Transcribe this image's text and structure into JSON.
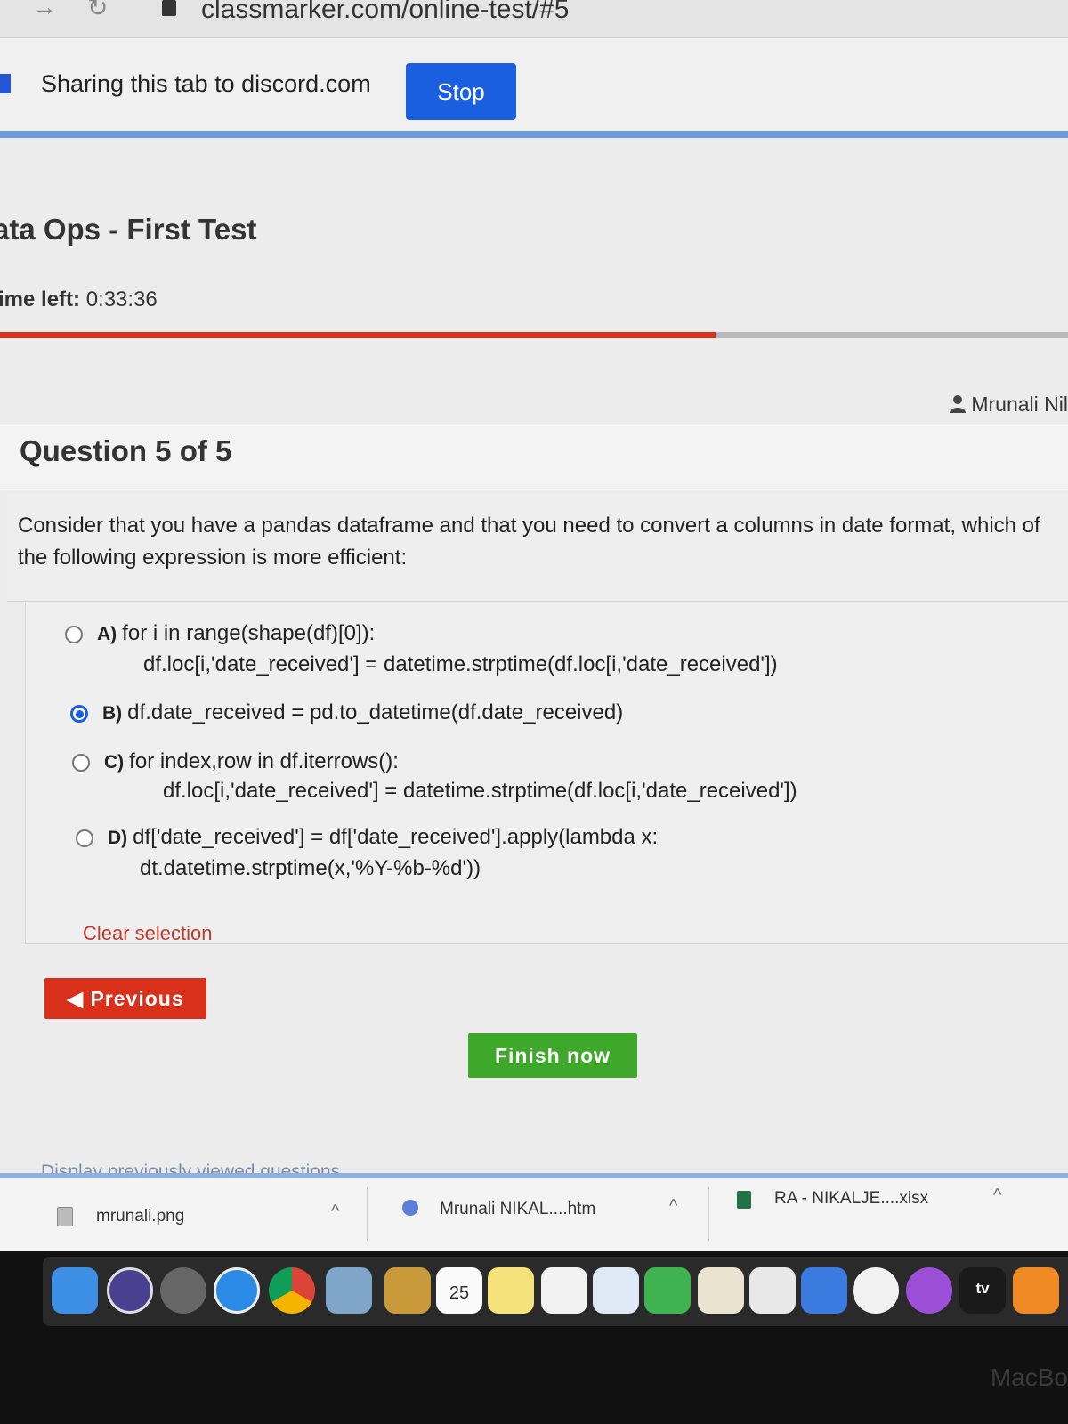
{
  "browser": {
    "url": "classmarker.com/online-test/#5"
  },
  "sharing": {
    "text": "Sharing this tab to discord.com",
    "stop_label": "Stop"
  },
  "test": {
    "title": "ata Ops - First Test",
    "timer_label": "ime left:",
    "timer_value": "0:33:36",
    "progress_fraction": 0.67
  },
  "user": {
    "name": "Mrunali Nil"
  },
  "question": {
    "header": "Question 5 of 5",
    "text": "Consider that you have a pandas dataframe and that you need to convert a columns in date format, which of the following expression is more efficient:",
    "options": [
      {
        "letter": "A)",
        "line1": "for i in range(shape(df)[0]):",
        "line2": "df.loc[i,'date_received'] = datetime.strptime(df.loc[i,'date_received'])",
        "selected": false
      },
      {
        "letter": "B)",
        "line1": "df.date_received = pd.to_datetime(df.date_received)",
        "line2": "",
        "selected": true
      },
      {
        "letter": "C)",
        "line1": "for index,row in df.iterrows():",
        "line2": "df.loc[i,'date_received'] = datetime.strptime(df.loc[i,'date_received'])",
        "selected": false
      },
      {
        "letter": "D)",
        "line1": "df['date_received'] = df['date_received'].apply(lambda x:",
        "line2": "dt.datetime.strptime(x,'%Y-%b-%d'))",
        "selected": false
      }
    ],
    "clear_label": "Clear selection"
  },
  "buttons": {
    "previous_label": "Previous",
    "finish_label": "Finish now"
  },
  "prev_viewed_label": "Display previously viewed questions",
  "downloads": [
    {
      "name": "mrunali.png"
    },
    {
      "name": "Mrunali NIKAL....htm"
    },
    {
      "name": "RA - NIKALJE....xlsx"
    }
  ],
  "dock": {
    "calendar_day": "25",
    "tv_label": "tv",
    "apps": [
      "finder-icon",
      "siri-icon",
      "launchpad-icon",
      "safari-icon",
      "chrome-icon",
      "preview-icon",
      "contacts-icon",
      "calendar-icon",
      "notes-icon",
      "reminders-icon",
      "keynote-icon",
      "facetime-icon",
      "textedit-icon",
      "numbers-icon",
      "keynote-podium-icon",
      "music-icon",
      "podcasts-icon",
      "appletv-icon",
      "books-icon"
    ]
  },
  "hardware_label": "MacBo",
  "colors": {
    "stop_button": "#1a5fe0",
    "progress": "#d7311f",
    "previous_button": "#d9301c",
    "finish_button": "#3ea82a",
    "clear_link": "#c0392b",
    "radio_selected": "#1a5fe0"
  }
}
